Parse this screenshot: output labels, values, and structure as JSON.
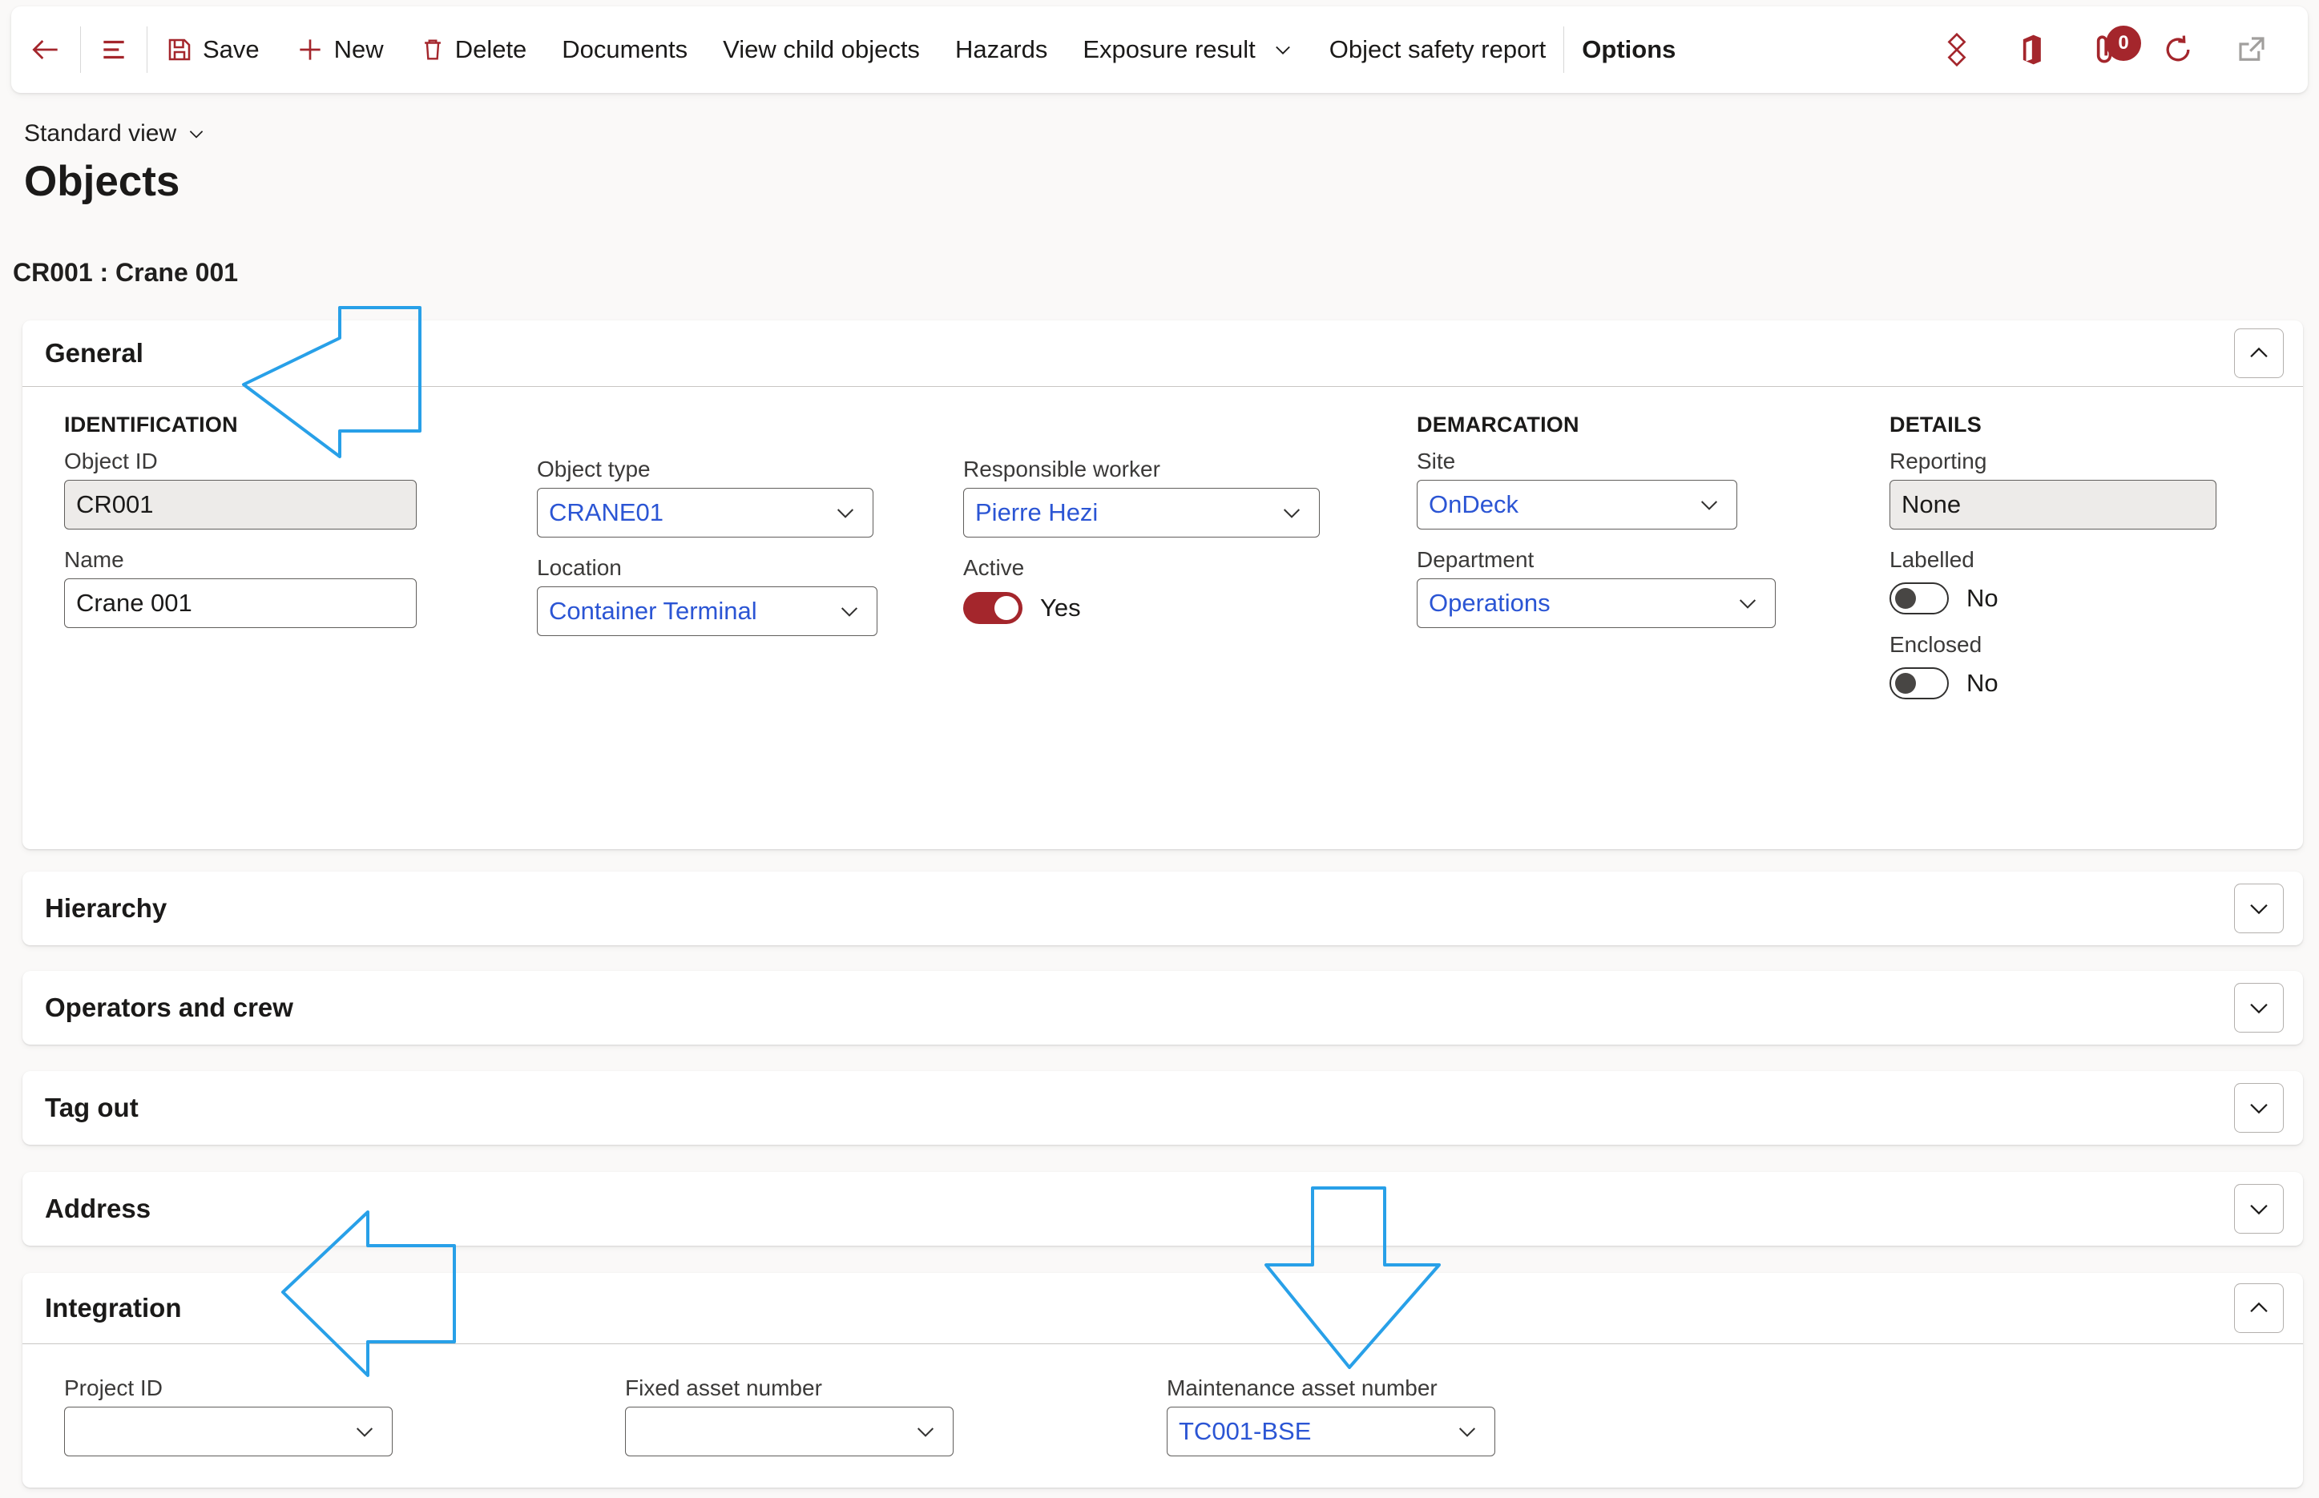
{
  "toolbar": {
    "back_icon": "back-arrow-icon",
    "hamburger_icon": "hamburger-menu-icon",
    "items": [
      {
        "label": "Save",
        "icon": "save-icon",
        "has_icon": true,
        "has_chevron": false,
        "bold": false
      },
      {
        "label": "New",
        "icon": "plus-icon",
        "has_icon": true,
        "has_chevron": false,
        "bold": false
      },
      {
        "label": "Delete",
        "icon": "trash-icon",
        "has_icon": true,
        "has_chevron": false,
        "bold": false
      },
      {
        "label": "Documents",
        "icon": "",
        "has_icon": false,
        "has_chevron": false,
        "bold": false
      },
      {
        "label": "View child objects",
        "icon": "",
        "has_icon": false,
        "has_chevron": false,
        "bold": false
      },
      {
        "label": "Hazards",
        "icon": "",
        "has_icon": false,
        "has_chevron": false,
        "bold": false
      },
      {
        "label": "Exposure result",
        "icon": "",
        "has_icon": false,
        "has_chevron": true,
        "bold": false
      },
      {
        "label": "Object safety report",
        "icon": "",
        "has_icon": false,
        "has_chevron": false,
        "bold": false
      },
      {
        "label": "Options",
        "icon": "",
        "has_icon": false,
        "has_chevron": false,
        "bold": true
      }
    ],
    "right_icons": [
      {
        "name": "power-bi-icon",
        "badge": null
      },
      {
        "name": "office-icon",
        "badge": null
      },
      {
        "name": "attachment-icon",
        "badge": "0"
      },
      {
        "name": "refresh-icon",
        "badge": null
      },
      {
        "name": "open-in-new-window-icon",
        "badge": null
      }
    ]
  },
  "header": {
    "view_selector": "Standard view",
    "page_title": "Objects",
    "record_caption": "CR001 : Crane 001"
  },
  "sections": {
    "general": {
      "title": "General",
      "expanded": true,
      "identification": {
        "group_header": "IDENTIFICATION",
        "object_id": {
          "label": "Object ID",
          "value": "CR001"
        },
        "name": {
          "label": "Name",
          "value": "Crane 001"
        }
      },
      "classification": {
        "object_type": {
          "label": "Object type",
          "value": "CRANE01"
        },
        "location": {
          "label": "Location",
          "value": "Container Terminal"
        }
      },
      "responsibility": {
        "responsible_worker": {
          "label": "Responsible worker",
          "value": "Pierre Hezi"
        },
        "active": {
          "label": "Active",
          "value": "Yes",
          "on": true
        }
      },
      "demarcation": {
        "group_header": "DEMARCATION",
        "site": {
          "label": "Site",
          "value": "OnDeck"
        },
        "department": {
          "label": "Department",
          "value": "Operations"
        }
      },
      "details": {
        "group_header": "DETAILS",
        "reporting": {
          "label": "Reporting",
          "value": "None"
        },
        "labelled": {
          "label": "Labelled",
          "value": "No",
          "on": false
        },
        "enclosed": {
          "label": "Enclosed",
          "value": "No",
          "on": false
        }
      }
    },
    "hierarchy": {
      "title": "Hierarchy",
      "expanded": false
    },
    "operators_and_crew": {
      "title": "Operators and crew",
      "expanded": false
    },
    "tag_out": {
      "title": "Tag out",
      "expanded": false
    },
    "address": {
      "title": "Address",
      "expanded": false
    },
    "integration": {
      "title": "Integration",
      "expanded": true,
      "project_id": {
        "label": "Project ID",
        "value": ""
      },
      "fixed_asset_number": {
        "label": "Fixed asset number",
        "value": ""
      },
      "maintenance_asset_number": {
        "label": "Maintenance asset number",
        "value": "TC001-BSE"
      }
    }
  },
  "annotations": {
    "color": "#28A0E8",
    "arrows": [
      {
        "name": "arrow-pointing-general-section",
        "direction": "left"
      },
      {
        "name": "arrow-pointing-integration-section",
        "direction": "left"
      },
      {
        "name": "arrow-pointing-maintenance-asset-number",
        "direction": "down"
      }
    ]
  },
  "colors": {
    "accent": "#a4262c",
    "link": "#2b55d4",
    "annotation": "#28A0E8",
    "page_background": "#faf9f8",
    "card_background": "#ffffff"
  }
}
